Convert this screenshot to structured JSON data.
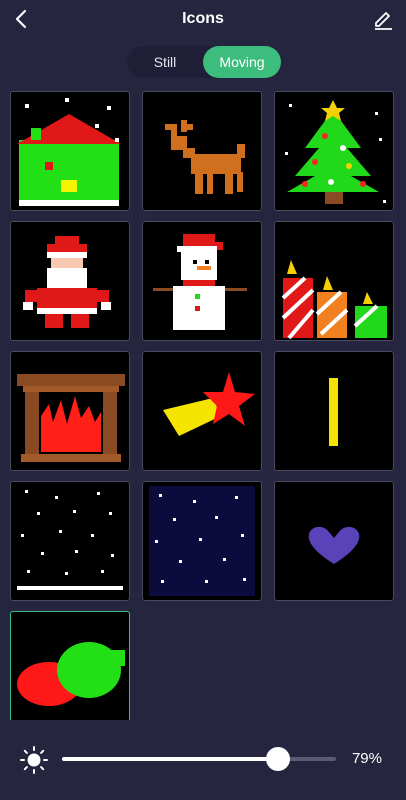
{
  "header": {
    "title": "Icons",
    "back_icon": "chevron-left-icon",
    "edit_icon": "pencil-icon"
  },
  "segment": {
    "options": [
      "Still",
      "Moving"
    ],
    "selected": "Moving",
    "accent": "#3dbd7d"
  },
  "icons": [
    {
      "name": "house-icon"
    },
    {
      "name": "reindeer-icon"
    },
    {
      "name": "christmas-tree-icon"
    },
    {
      "name": "santa-icon"
    },
    {
      "name": "snowman-icon"
    },
    {
      "name": "candles-icon"
    },
    {
      "name": "fireplace-icon"
    },
    {
      "name": "shooting-star-icon"
    },
    {
      "name": "bar-icon"
    },
    {
      "name": "snowfall-icon"
    },
    {
      "name": "night-sky-icon"
    },
    {
      "name": "heart-icon"
    },
    {
      "name": "blob-icon",
      "selected": true
    }
  ],
  "brightness": {
    "icon": "sun-icon",
    "value": 0.79,
    "label": "79%"
  }
}
